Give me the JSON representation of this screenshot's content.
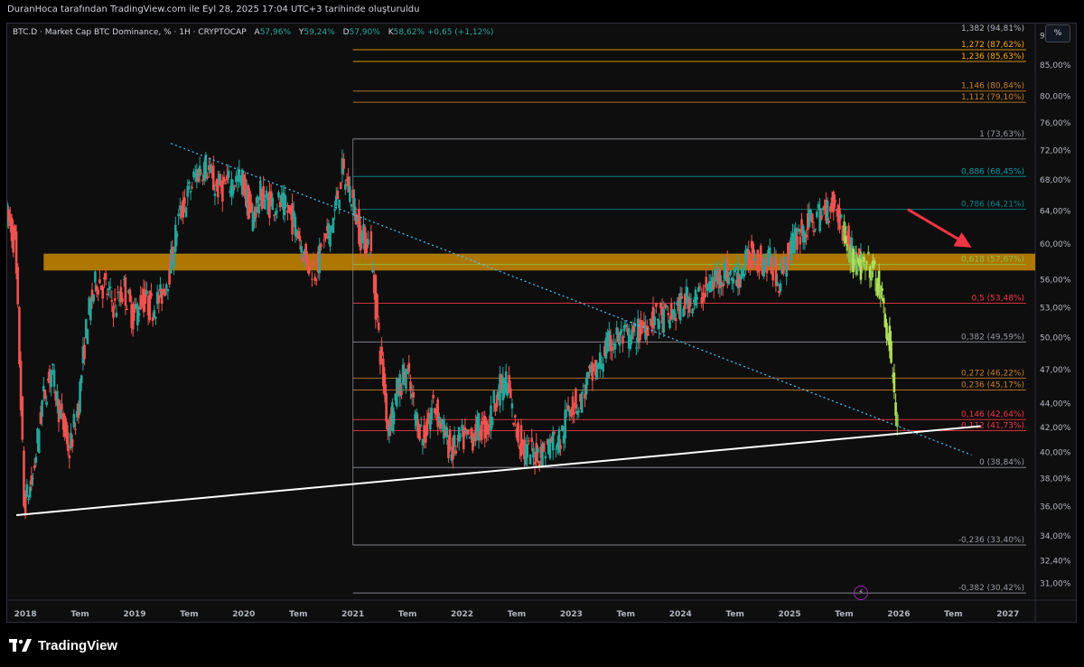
{
  "caption": "DuranHoca tarafından TradingView.com ile Eyl 28, 2025 17:04 UTC+3 tarihinde oluşturuldu",
  "legend": {
    "symbol": "BTC.D · Market Cap BTC Dominance, % · 1H · CRYPTOCAP",
    "a_label": "A",
    "a_value": "57,96%",
    "y_label": "Y",
    "y_value": "59,24%",
    "d_label": "D",
    "d_value": "57,90%",
    "k_label": "K",
    "k_value": "58,62% +0,65 (+1,12%)"
  },
  "unit_button": "%",
  "brand": "TradingView",
  "colors": {
    "up": "#26a69a",
    "down": "#ef5350",
    "projection": "#8bc34a",
    "zone": "#c98a00",
    "arrow": "#f23645",
    "trend_line": "#ffffff",
    "dotted_line": "#4fc3f7"
  },
  "chart_data": {
    "type": "candlestick",
    "y_axis": {
      "range": [
        30.0,
        92.2
      ],
      "scale": "log",
      "ticks": [
        "31,00%",
        "32,40%",
        "34,00%",
        "36,00%",
        "38,00%",
        "40,00%",
        "42,00%",
        "44,00%",
        "47,00%",
        "50,00%",
        "53,00%",
        "56,00%",
        "60,00%",
        "64,00%",
        "68,00%",
        "72,00%",
        "76,00%",
        "80,00%",
        "85,00%",
        "90,00%"
      ]
    },
    "x_axis": {
      "range": [
        "2017-11",
        "2027-04"
      ],
      "ticks": [
        {
          "date": "2018-01",
          "label": "2018"
        },
        {
          "date": "2018-07",
          "label": "Tem"
        },
        {
          "date": "2019-01",
          "label": "2019"
        },
        {
          "date": "2019-07",
          "label": "Tem"
        },
        {
          "date": "2020-01",
          "label": "2020"
        },
        {
          "date": "2020-07",
          "label": "Tem"
        },
        {
          "date": "2021-01",
          "label": "2021"
        },
        {
          "date": "2021-07",
          "label": "Tem"
        },
        {
          "date": "2022-01",
          "label": "2022"
        },
        {
          "date": "2022-07",
          "label": "Tem"
        },
        {
          "date": "2023-01",
          "label": "2023"
        },
        {
          "date": "2023-07",
          "label": "Tem"
        },
        {
          "date": "2024-01",
          "label": "2024"
        },
        {
          "date": "2024-07",
          "label": "Tem"
        },
        {
          "date": "2025-01",
          "label": "2025"
        },
        {
          "date": "2025-07",
          "label": "Tem"
        },
        {
          "date": "2026-01",
          "label": "2026"
        },
        {
          "date": "2026-07",
          "label": "Tem"
        },
        {
          "date": "2027-01",
          "label": "2027"
        }
      ]
    },
    "price_path": [
      [
        "2017-11",
        64
      ],
      [
        "2017-12",
        60
      ],
      [
        "2018-01",
        36
      ],
      [
        "2018-02",
        38
      ],
      [
        "2018-03",
        44
      ],
      [
        "2018-04",
        47
      ],
      [
        "2018-05",
        43
      ],
      [
        "2018-06",
        40
      ],
      [
        "2018-07",
        44
      ],
      [
        "2018-08",
        52
      ],
      [
        "2018-09",
        56
      ],
      [
        "2018-10",
        55
      ],
      [
        "2018-11",
        53
      ],
      [
        "2018-12",
        55
      ],
      [
        "2019-01",
        52
      ],
      [
        "2019-02",
        54
      ],
      [
        "2019-03",
        53
      ],
      [
        "2019-04",
        54
      ],
      [
        "2019-05",
        57
      ],
      [
        "2019-06",
        63
      ],
      [
        "2019-07",
        66
      ],
      [
        "2019-08",
        69
      ],
      [
        "2019-09",
        70
      ],
      [
        "2019-10",
        67
      ],
      [
        "2019-11",
        67
      ],
      [
        "2019-12",
        68
      ],
      [
        "2020-01",
        68
      ],
      [
        "2020-02",
        63
      ],
      [
        "2020-03",
        66
      ],
      [
        "2020-04",
        65
      ],
      [
        "2020-05",
        65
      ],
      [
        "2020-06",
        64
      ],
      [
        "2020-07",
        62
      ],
      [
        "2020-08",
        58
      ],
      [
        "2020-09",
        57
      ],
      [
        "2020-10",
        60
      ],
      [
        "2020-11",
        63
      ],
      [
        "2020-12",
        69
      ],
      [
        "2021-01",
        66
      ],
      [
        "2021-02",
        61
      ],
      [
        "2021-03",
        60
      ],
      [
        "2021-04",
        50
      ],
      [
        "2021-05",
        42
      ],
      [
        "2021-06",
        45
      ],
      [
        "2021-07",
        47
      ],
      [
        "2021-08",
        43
      ],
      [
        "2021-09",
        41
      ],
      [
        "2021-10",
        44
      ],
      [
        "2021-11",
        42
      ],
      [
        "2021-12",
        40
      ],
      [
        "2022-01",
        41
      ],
      [
        "2022-02",
        41
      ],
      [
        "2022-03",
        42
      ],
      [
        "2022-04",
        42
      ],
      [
        "2022-05",
        45
      ],
      [
        "2022-06",
        46
      ],
      [
        "2022-07",
        42
      ],
      [
        "2022-08",
        40
      ],
      [
        "2022-09",
        40
      ],
      [
        "2022-10",
        40
      ],
      [
        "2022-11",
        41
      ],
      [
        "2022-12",
        41
      ],
      [
        "2023-01",
        44
      ],
      [
        "2023-02",
        44
      ],
      [
        "2023-03",
        46
      ],
      [
        "2023-04",
        47
      ],
      [
        "2023-05",
        49
      ],
      [
        "2023-06",
        50
      ],
      [
        "2023-07",
        50
      ],
      [
        "2023-08",
        50
      ],
      [
        "2023-09",
        51
      ],
      [
        "2023-10",
        52
      ],
      [
        "2023-11",
        52
      ],
      [
        "2023-12",
        52
      ],
      [
        "2024-01",
        53
      ],
      [
        "2024-02",
        54
      ],
      [
        "2024-03",
        54
      ],
      [
        "2024-04",
        55
      ],
      [
        "2024-05",
        56
      ],
      [
        "2024-06",
        57
      ],
      [
        "2024-07",
        56
      ],
      [
        "2024-08",
        57
      ],
      [
        "2024-09",
        59
      ],
      [
        "2024-10",
        58
      ],
      [
        "2024-11",
        58
      ],
      [
        "2024-12",
        56
      ],
      [
        "2025-01",
        59
      ],
      [
        "2025-02",
        61
      ],
      [
        "2025-03",
        62
      ],
      [
        "2025-04",
        63
      ],
      [
        "2025-05",
        64
      ],
      [
        "2025-06",
        65
      ],
      [
        "2025-07",
        62
      ],
      [
        "2025-08",
        59
      ],
      [
        "2025-09",
        58
      ]
    ],
    "projection": [
      [
        "2025-07",
        62
      ],
      [
        "2025-08",
        58
      ],
      [
        "2025-09",
        57
      ],
      [
        "2025-10",
        57.5
      ],
      [
        "2025-11",
        55
      ],
      [
        "2025-12",
        50
      ],
      [
        "2026-01",
        42
      ]
    ],
    "fib_levels": [
      {
        "label": "1,382 (94,81%)",
        "value": 94.81,
        "color": "#b2b5be"
      },
      {
        "label": "1,272 (87,62%)",
        "value": 87.62,
        "color": "#f7a600"
      },
      {
        "label": "1,236 (85,63%)",
        "value": 85.63,
        "color": "#f7a600"
      },
      {
        "label": "1,146 (80,84%)",
        "value": 80.84,
        "color": "#c77f2a"
      },
      {
        "label": "1,112 (79,10%)",
        "value": 79.1,
        "color": "#c77f2a"
      },
      {
        "label": "1 (73,63%)",
        "value": 73.63,
        "color": "#9598a1"
      },
      {
        "label": "0,886 (68,45%)",
        "value": 68.45,
        "color": "#0097a7"
      },
      {
        "label": "0,786 (64,21%)",
        "value": 64.21,
        "color": "#00838f"
      },
      {
        "label": "0,618 (57,67%)",
        "value": 57.67,
        "color": "#8bc34a"
      },
      {
        "label": "0,5 (53,48%)",
        "value": 53.48,
        "color": "#f23645"
      },
      {
        "label": "0,382 (49,59%)",
        "value": 49.59,
        "color": "#9598a1"
      },
      {
        "label": "0,272 (46,22%)",
        "value": 46.22,
        "color": "#c77f2a"
      },
      {
        "label": "0,236 (45,17%)",
        "value": 45.17,
        "color": "#c77f2a"
      },
      {
        "label": "0,146 (42,64%)",
        "value": 42.64,
        "color": "#f23645"
      },
      {
        "label": "0,112 (41,73%)",
        "value": 41.73,
        "color": "#f23645"
      },
      {
        "label": "0 (38,84%)",
        "value": 38.84,
        "color": "#9598a1"
      },
      {
        "label": "-0,236 (33,40%)",
        "value": 33.4,
        "color": "#9598a1"
      },
      {
        "label": "-0,382 (30,42%)",
        "value": 30.42,
        "color": "#9598a1"
      }
    ],
    "fib_start": "2021-01",
    "zone": {
      "low": 57.0,
      "high": 58.9,
      "start": "2017-12",
      "end": "2027-04"
    },
    "trend_line": [
      [
        "2017-12",
        35.4
      ],
      [
        "2026-10",
        42.1
      ]
    ],
    "dotted_line": [
      [
        "2019-05",
        73.0
      ],
      [
        "2026-09",
        39.8
      ]
    ],
    "arrow": [
      [
        "2026-02",
        64.2
      ],
      [
        "2026-09",
        59.6
      ]
    ]
  }
}
